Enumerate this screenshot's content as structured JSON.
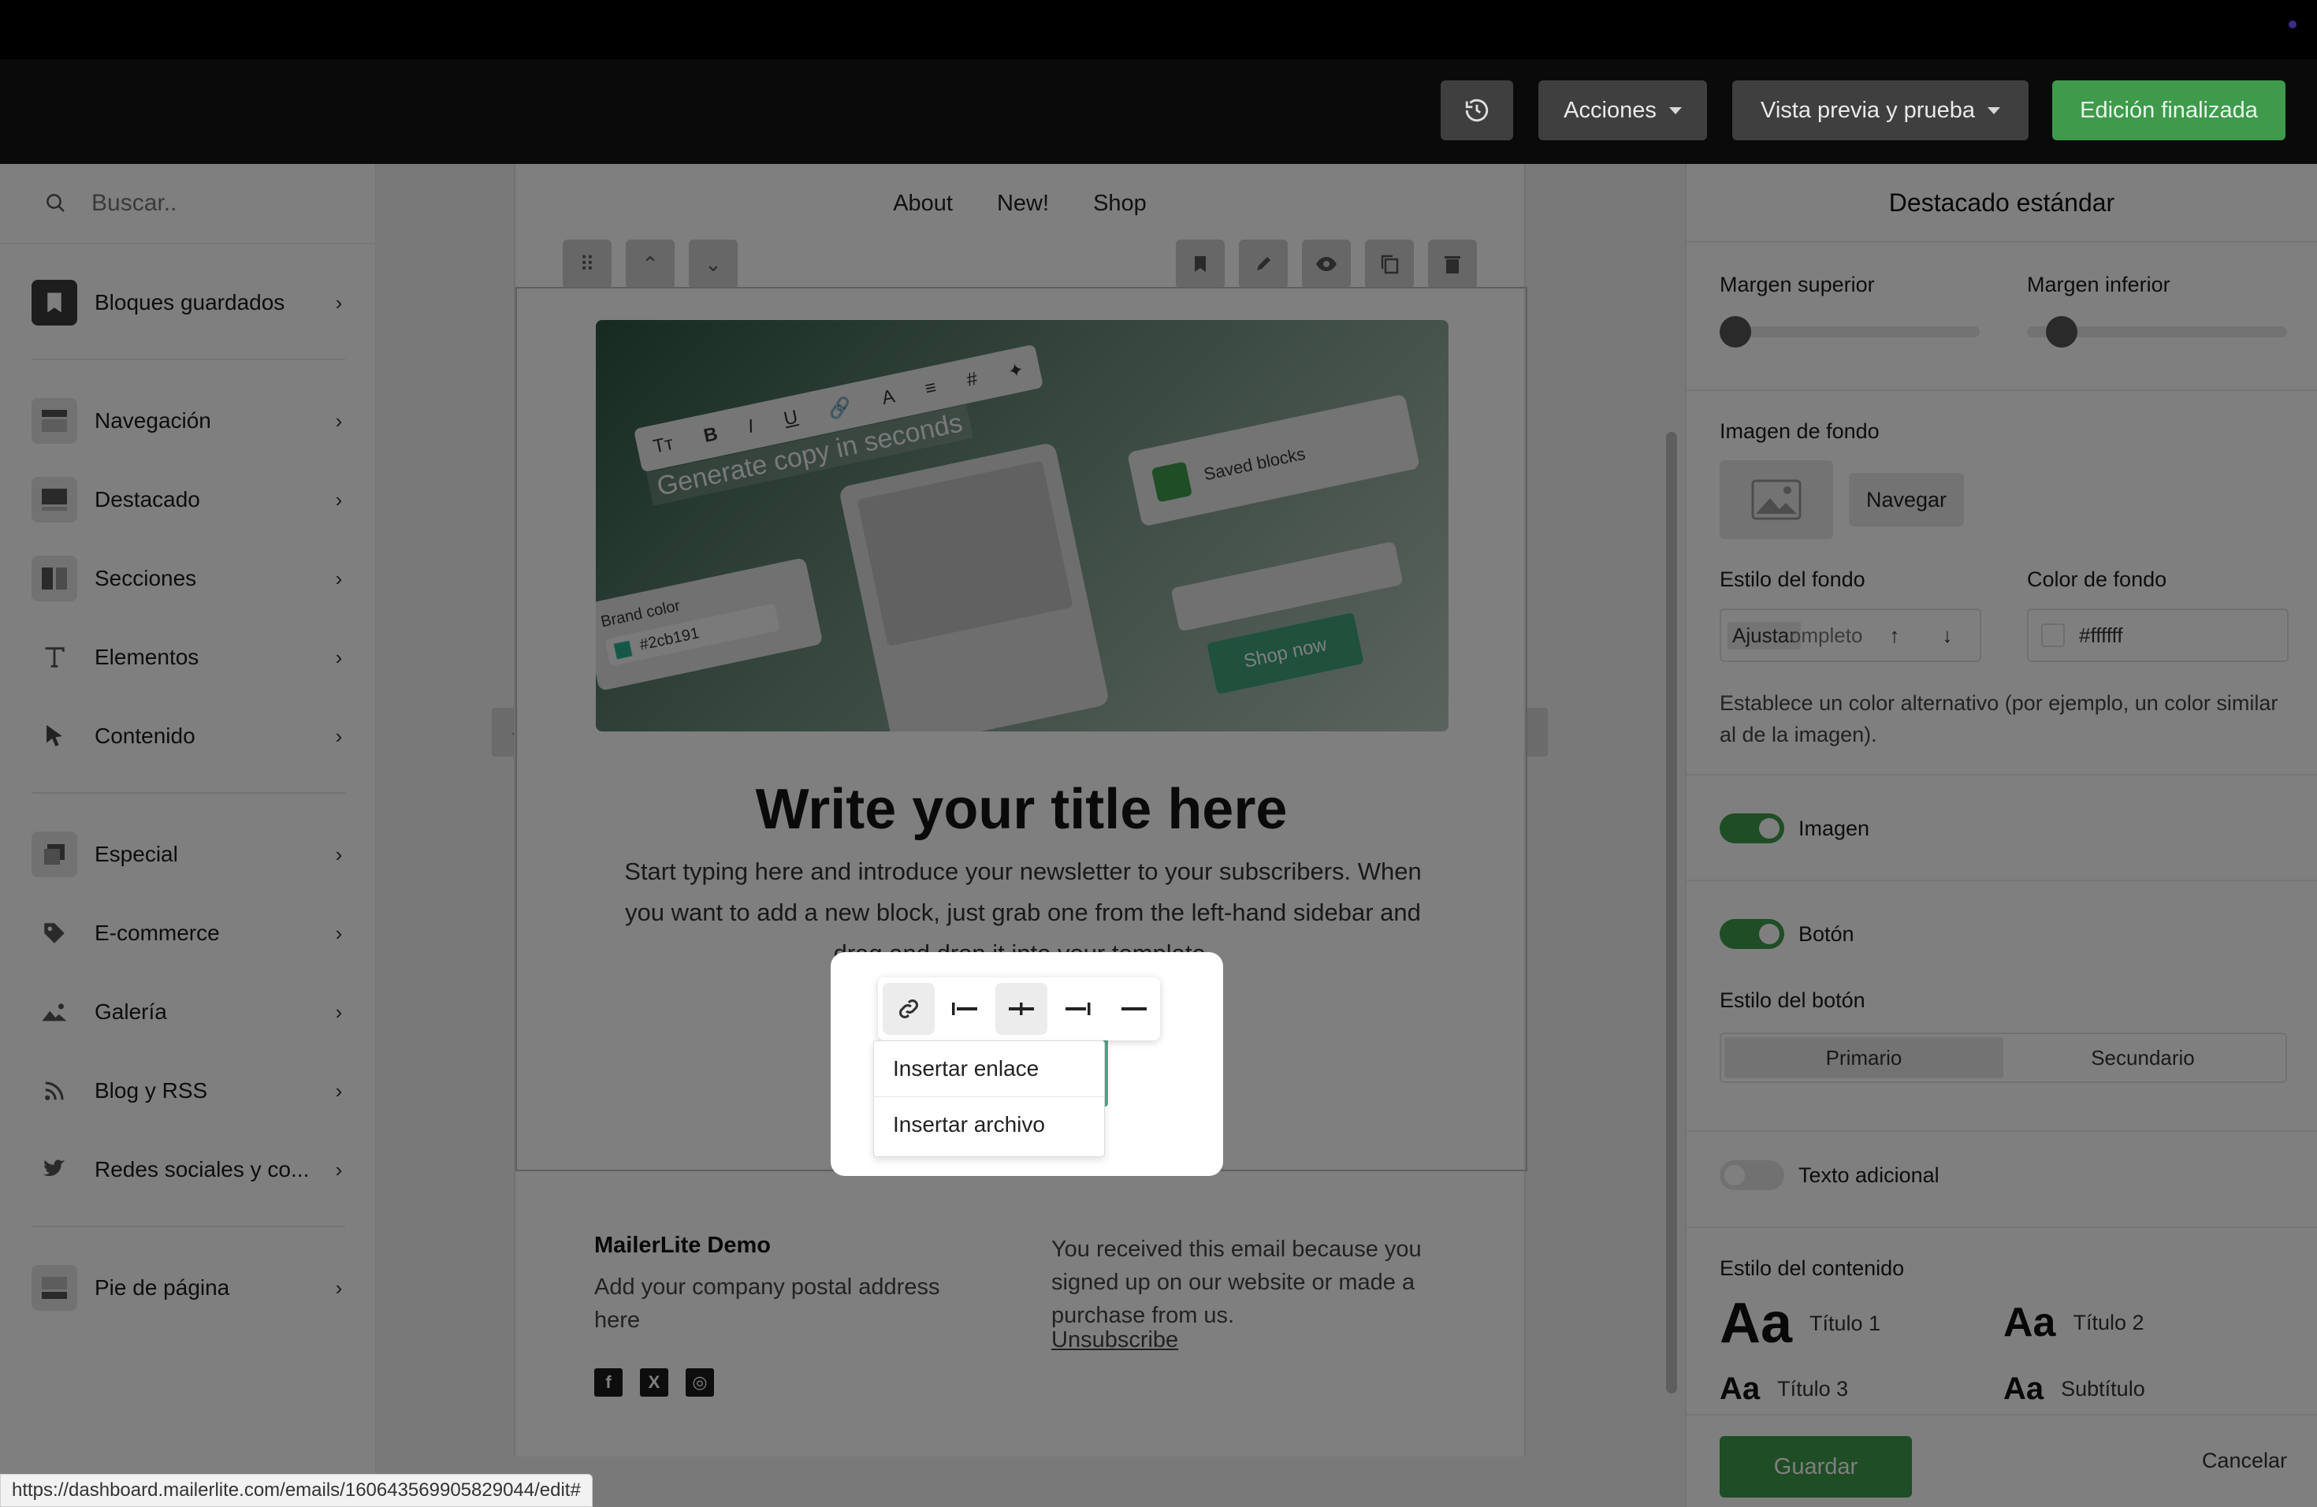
{
  "header": {
    "acciones_label": "Acciones",
    "vista_label": "Vista previa y prueba",
    "finalizada_label": "Edición finalizada"
  },
  "sidebar": {
    "search_placeholder": "Buscar..",
    "items": [
      {
        "label": "Bloques guardados",
        "icon": "bookmark-icon"
      },
      {
        "label": "Navegación",
        "icon": "navigation-block-icon"
      },
      {
        "label": "Destacado",
        "icon": "featured-block-icon"
      },
      {
        "label": "Secciones",
        "icon": "sections-icon"
      },
      {
        "label": "Elementos",
        "icon": "text-element-icon"
      },
      {
        "label": "Contenido",
        "icon": "cursor-icon"
      },
      {
        "label": "Especial",
        "icon": "special-icon"
      },
      {
        "label": "E-commerce",
        "icon": "tag-icon"
      },
      {
        "label": "Galería",
        "icon": "image-icon"
      },
      {
        "label": "Blog y RSS",
        "icon": "rss-icon"
      },
      {
        "label": "Redes sociales y co...",
        "icon": "twitter-icon"
      },
      {
        "label": "Pie de página",
        "icon": "footer-block-icon"
      }
    ]
  },
  "email": {
    "nav": [
      "About",
      "New!",
      "Shop"
    ],
    "hero_image": {
      "generate_text": "Generate copy in seconds",
      "saved_blocks": "Saved blocks",
      "brand_color_label": "Brand color",
      "brand_color_value": "#2cb191",
      "shop_now": "Shop now"
    },
    "title": "Write your title here",
    "intro": "Start typing here and introduce your newsletter to your subscribers. When you want to add a new block, just grab one from the left-hand sidebar and drag and drop it into your template.",
    "footer": {
      "company": "MailerLite Demo",
      "address": "Add your company postal address here",
      "notice": "You received this email because you signed up on our website or made a purchase from us.",
      "unsubscribe": "Unsubscribe",
      "social": [
        "f",
        "X",
        "◎"
      ]
    }
  },
  "popup": {
    "menu": [
      "Insertar enlace",
      "Insertar archivo"
    ]
  },
  "panel": {
    "title": "Destacado estándar",
    "margen_superior": "Margen superior",
    "margen_inferior": "Margen inferior",
    "imagen_fondo": "Imagen de fondo",
    "navegar": "Navegar",
    "estilo_fondo": "Estilo del fondo",
    "estilo_fondo_value": "Ajustar",
    "estilo_fondo_overlap": "ompleto",
    "color_fondo": "Color de fondo",
    "color_fondo_value": "#ffffff",
    "help": "Establece un color alternativo (por ejemplo, un color similar al de la imagen).",
    "imagen_toggle": "Imagen",
    "boton_toggle": "Botón",
    "estilo_boton": "Estilo del botón",
    "boton_options": [
      "Primario",
      "Secundario"
    ],
    "texto_adicional": "Texto adicional",
    "estilo_contenido": "Estilo del contenido",
    "styles": [
      {
        "sample": "Aa",
        "label": "Título 1"
      },
      {
        "sample": "Aa",
        "label": "Título 2"
      },
      {
        "sample": "Aa",
        "label": "Título 3"
      },
      {
        "sample": "Aa",
        "label": "Subtítulo"
      }
    ],
    "guardar": "Guardar",
    "cancelar": "Cancelar"
  },
  "status_url": "https://dashboard.mailerlite.com/emails/160643569905829044/edit#",
  "colors": {
    "accent_green": "#3f9a4c",
    "button_green": "#4aae8d",
    "header_bg": "#0a0a0a"
  }
}
